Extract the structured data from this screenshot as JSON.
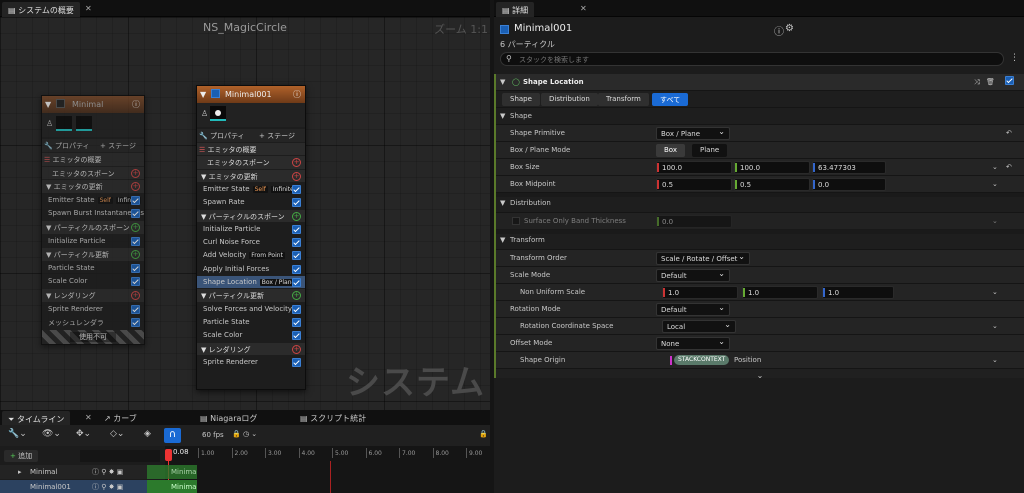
{
  "left_tab": {
    "title": "システムの概要"
  },
  "graph": {
    "title": "NS_MagicCircle",
    "zoom": "ズーム 1:1",
    "watermark": "システム"
  },
  "node_minimal": {
    "title": "Minimal",
    "tab_properties": "プロパティ",
    "tab_stage": "ステージ",
    "rows": [
      "エミッタの概要",
      "エミッタのスポーン",
      "エミッタの更新",
      "Emitter State",
      "Spawn Burst Instantaneous",
      "パーティクルのスポーン",
      "Initialize Particle",
      "パーティクル更新",
      "Particle State",
      "Scale Color",
      "レンダリング",
      "Sprite Renderer",
      "メッシュレンダラ"
    ],
    "emitter_state_tags": [
      "Self",
      "Infinite"
    ],
    "footer": "使用不可"
  },
  "node_main": {
    "title": "Minimal001",
    "tab_properties": "プロパティ",
    "tab_stage": "ステージ",
    "rows": [
      "エミッタの概要",
      "エミッタのスポーン",
      "エミッタの更新",
      "Emitter State",
      "Spawn Rate",
      "パーティクルのスポーン",
      "Initialize Particle",
      "Curl Noise Force",
      "Add Velocity",
      "Apply Initial Forces",
      "Shape Location",
      "パーティクル更新",
      "Solve Forces and Velocity",
      "Particle State",
      "Scale Color",
      "レンダリング",
      "Sprite Renderer"
    ],
    "emitter_state_tags": [
      "Self",
      "Infinite"
    ],
    "add_velocity_tag": "From Point",
    "shape_location_tag": "Box / Plane"
  },
  "details": {
    "tab_title": "詳細",
    "emitter_name": "Minimal001",
    "particle_count": "6 パーティクル",
    "search_placeholder": "スタックを検索します",
    "module_title": "Shape Location",
    "filter_tabs": [
      "Shape",
      "Distribution",
      "Transform",
      "すべて"
    ],
    "shape": {
      "header": "Shape",
      "primitive_label": "Shape Primitive",
      "primitive_value": "Box / Plane",
      "mode_label": "Box / Plane Mode",
      "mode_options": [
        "Box",
        "Plane"
      ],
      "box_size_label": "Box Size",
      "box_size": [
        "100.0",
        "100.0",
        "63.477303"
      ],
      "box_midpoint_label": "Box Midpoint",
      "box_midpoint": [
        "0.5",
        "0.5",
        "0.0"
      ]
    },
    "distribution": {
      "header": "Distribution",
      "surface_label": "Surface Only Band Thickness",
      "surface_value": "0.0"
    },
    "transform": {
      "header": "Transform",
      "order_label": "Transform Order",
      "order_value": "Scale / Rotate / Offset",
      "scale_mode_label": "Scale Mode",
      "scale_mode_value": "Default",
      "nonuniform_label": "Non Uniform Scale",
      "nonuniform": [
        "1.0",
        "1.0",
        "1.0"
      ],
      "rot_mode_label": "Rotation Mode",
      "rot_mode_value": "Default",
      "rot_space_label": "Rotation Coordinate Space",
      "rot_space_value": "Local",
      "offset_mode_label": "Offset Mode",
      "offset_mode_value": "None",
      "origin_label": "Shape Origin",
      "origin_badge": "STACKCONTEXT",
      "origin_value": "Position"
    }
  },
  "timeline": {
    "tabs": [
      "タイムライン",
      "カーブ",
      "Niagaraログ",
      "スクリプト統計"
    ],
    "fps": "60 fps",
    "add_label": "追加",
    "playhead": "0.08",
    "ticks": [
      "1.00",
      "2.00",
      "3.00",
      "4.00",
      "5.00",
      "6.00",
      "7.00",
      "8.00",
      "9.00"
    ],
    "tracks": [
      "Minimal",
      "Minimal001"
    ],
    "track_labels": [
      "Minima",
      "Minima"
    ]
  }
}
